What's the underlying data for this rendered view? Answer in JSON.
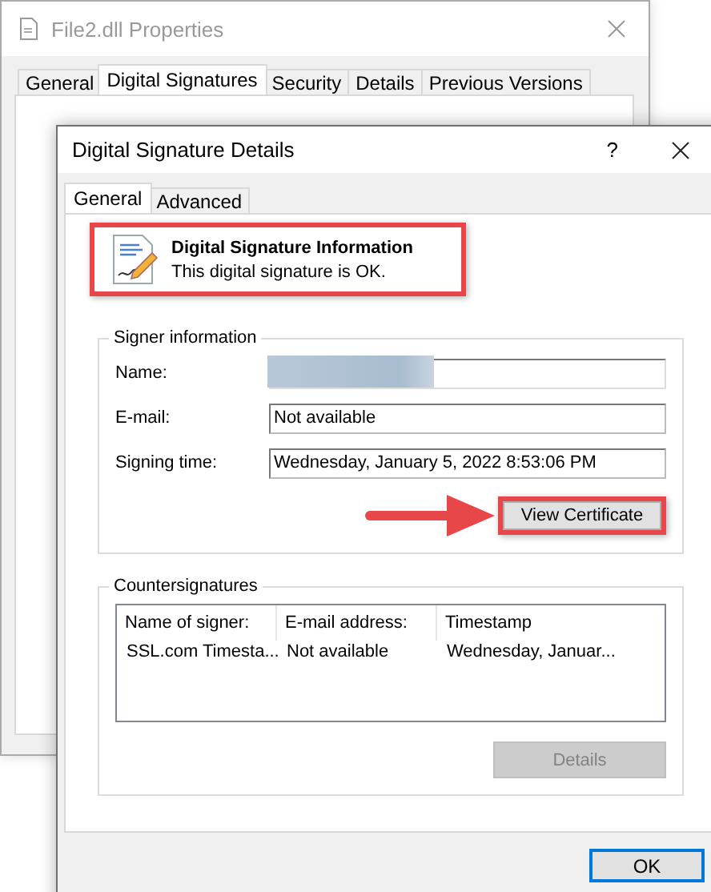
{
  "background_window": {
    "title": "File2.dll Properties",
    "tabs": [
      {
        "label": "General",
        "selected": false
      },
      {
        "label": "Digital Signatures",
        "selected": true
      },
      {
        "label": "Security",
        "selected": false
      },
      {
        "label": "Details",
        "selected": false
      },
      {
        "label": "Previous Versions",
        "selected": false
      }
    ]
  },
  "dialog": {
    "title": "Digital Signature Details",
    "help": "?",
    "tabs": [
      {
        "label": "General",
        "selected": true
      },
      {
        "label": "Advanced",
        "selected": false
      }
    ],
    "info": {
      "title": "Digital Signature Information",
      "message": "This digital signature is OK.",
      "highlighted": true
    },
    "signer": {
      "title": "Signer information",
      "fields": [
        {
          "label": "Name:",
          "redacted": true
        },
        {
          "label": "E-mail:",
          "value": "Not available",
          "redacted": false
        },
        {
          "label": "Signing time:",
          "value": "Wednesday, January 5, 2022 8:53:06 PM",
          "redacted": false
        }
      ],
      "view_certificate": {
        "label": "View Certificate",
        "highlighted": true
      }
    },
    "countersignatures": {
      "title": "Countersignatures",
      "columns": [
        "Name of signer:",
        "E-mail address:",
        "Timestamp"
      ],
      "rows": [
        {
          "cells": [
            "SSL.com Timesta...",
            "Not available",
            "Wednesday, Januar..."
          ],
          "selected": false
        }
      ],
      "details_button": {
        "label": "Details",
        "disabled": true
      }
    },
    "ok_button": {
      "label": "OK",
      "default": true
    }
  }
}
